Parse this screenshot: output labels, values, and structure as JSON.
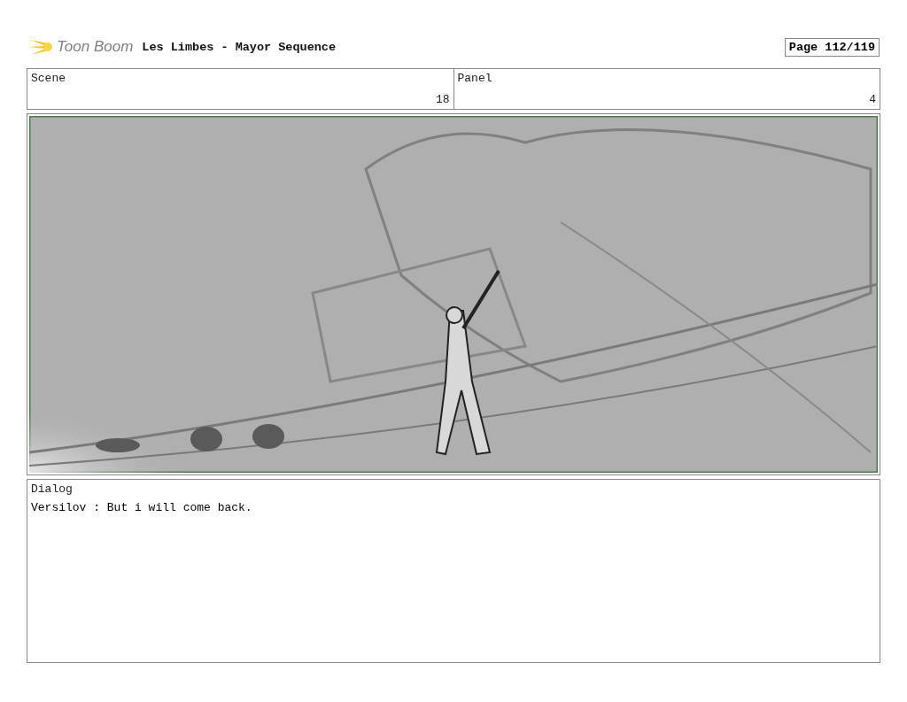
{
  "header": {
    "logo_text": "Toon Boom",
    "title": "Les Limbes - Mayor Sequence",
    "page": "Page 112/119"
  },
  "scene": {
    "label": "Scene",
    "value": "18"
  },
  "panel": {
    "label": "Panel",
    "value": "4"
  },
  "dialog": {
    "label": "Dialog",
    "text": "Versilov : But i will come back."
  }
}
